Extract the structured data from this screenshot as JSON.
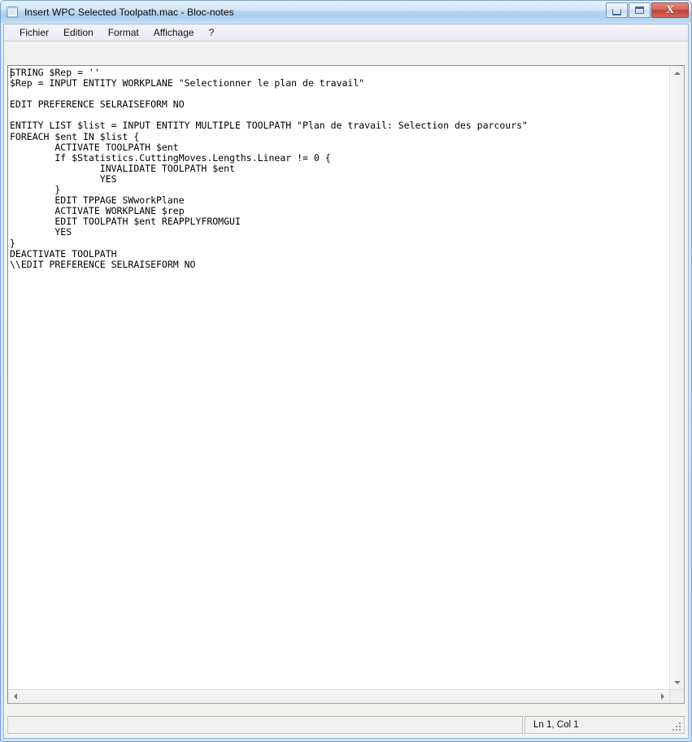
{
  "window": {
    "title": "Insert WPC Selected Toolpath.mac - Bloc-notes",
    "app_icon": "notepad-icon",
    "controls": {
      "minimize": "minimize-icon",
      "maximize": "maximize-icon",
      "close": "X"
    }
  },
  "menubar": {
    "items": [
      {
        "label": "Fichier",
        "name": "menu-fichier"
      },
      {
        "label": "Edition",
        "name": "menu-edition"
      },
      {
        "label": "Format",
        "name": "menu-format"
      },
      {
        "label": "Affichage",
        "name": "menu-affichage"
      },
      {
        "label": "?",
        "name": "menu-help"
      }
    ]
  },
  "editor": {
    "content": "STRING $Rep = ''\n$Rep = INPUT ENTITY WORKPLANE \"Selectionner le plan de travail\"\n\nEDIT PREFERENCE SELRAISEFORM NO\n\nENTITY LIST $list = INPUT ENTITY MULTIPLE TOOLPATH \"Plan de travail: Selection des parcours\"\nFOREACH $ent IN $list {\n        ACTIVATE TOOLPATH $ent\n        If $Statistics.CuttingMoves.Lengths.Linear != 0 {\n                INVALIDATE TOOLPATH $ent\n                YES\n        }\n        EDIT TPPAGE SWworkPlane\n        ACTIVATE WORKPLANE $rep\n        EDIT TOOLPATH $ent REAPPLYFROMGUI\n        YES\n}\nDEACTIVATE TOOLPATH\n\\\\EDIT PREFERENCE SELRAISEFORM NO",
    "caret_visible": true
  },
  "scrollbars": {
    "vertical": {
      "up": "scroll-up-icon",
      "down": "scroll-down-icon"
    },
    "horizontal": {
      "left": "scroll-left-icon",
      "right": "scroll-right-icon"
    }
  },
  "statusbar": {
    "left_text": "",
    "position": "Ln 1, Col 1"
  },
  "colors": {
    "titlebar_accent": "#b9d8f2",
    "close_button": "#bf4034",
    "window_border": "#7ba2cc",
    "editor_background": "#ffffff",
    "text": "#000000"
  }
}
